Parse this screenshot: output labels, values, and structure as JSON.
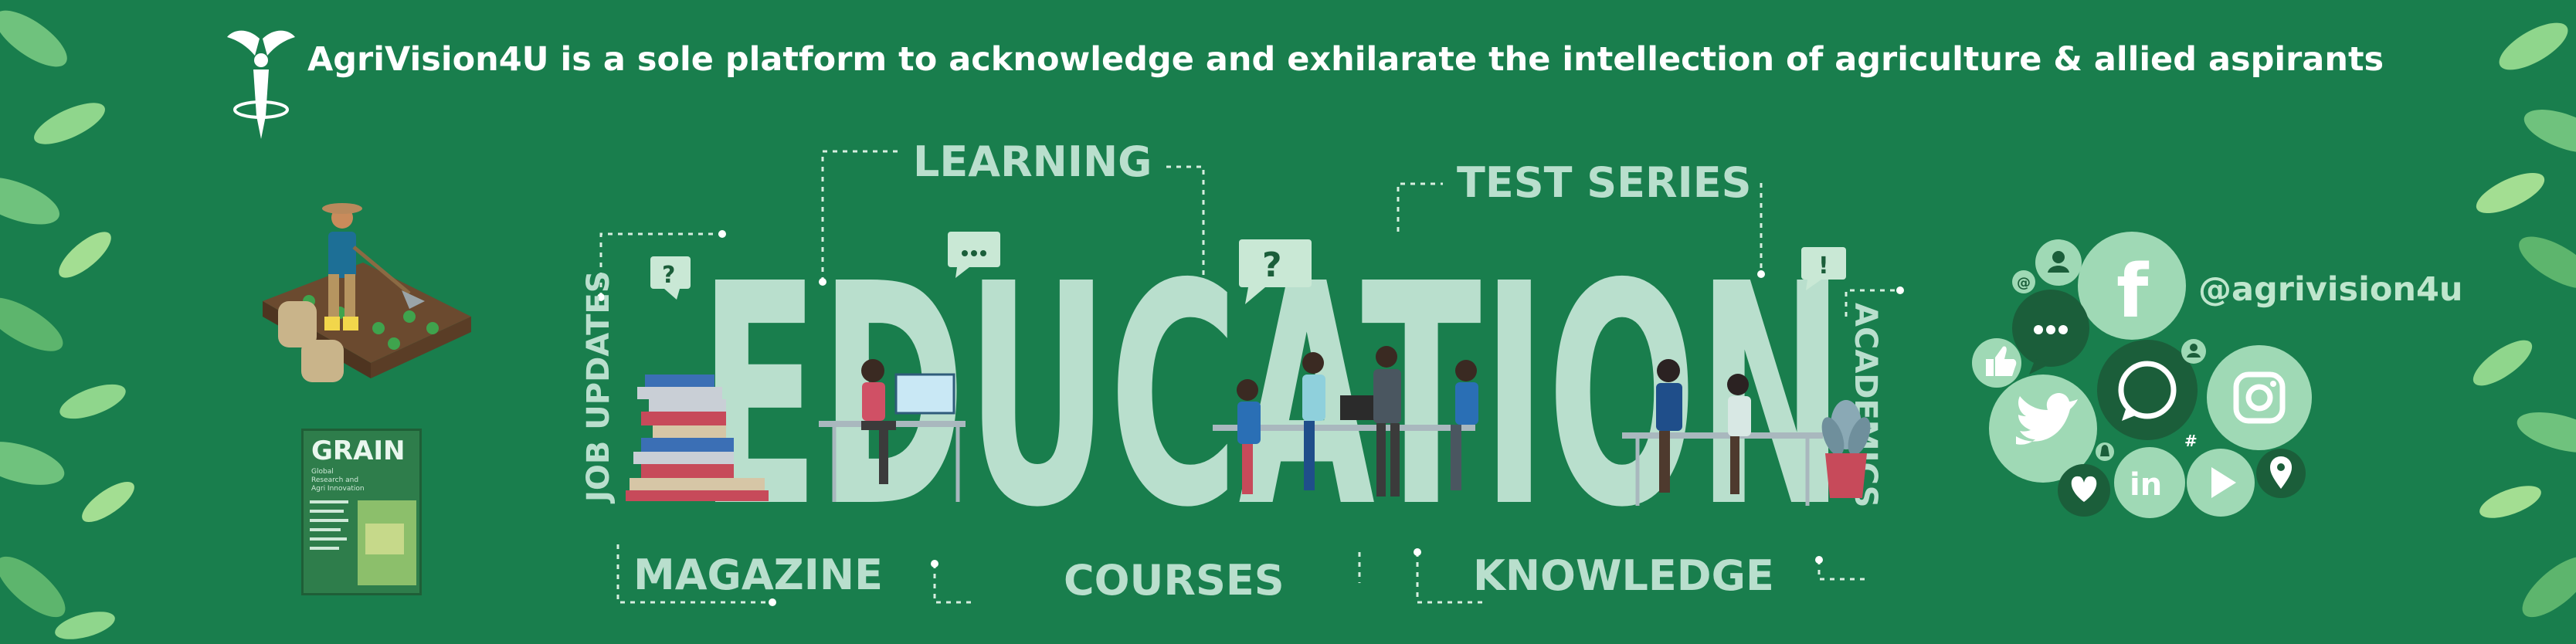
{
  "tagline": "AgriVision4U is a sole platform to acknowledge and exhilarate the intellection of agriculture & allied aspirants",
  "headline": "EDUCATION",
  "categories": {
    "learning": "LEARNING",
    "test_series": "TEST SERIES",
    "job_updates": "JOB UPDATES",
    "academics": "ACADEMICS",
    "magazine": "MAGAZINE",
    "courses": "COURSES",
    "knowledge": "KNOWLEDGE"
  },
  "magazine_cover": {
    "title": "GRAIN",
    "subtitle": "Global Research and Agri Innovation"
  },
  "social": {
    "handle": "@agrivision4u",
    "icons": [
      "facebook-icon",
      "whatsapp-icon",
      "instagram-icon",
      "twitter-icon",
      "linkedin-icon",
      "youtube-icon",
      "location-icon",
      "heart-icon",
      "like-icon",
      "chat-icon"
    ]
  },
  "colors": {
    "background": "#197e4d",
    "headline": "#b9dfcd",
    "accent_light": "#9fd9b5",
    "bubble_dark": "#1b5e3a"
  }
}
